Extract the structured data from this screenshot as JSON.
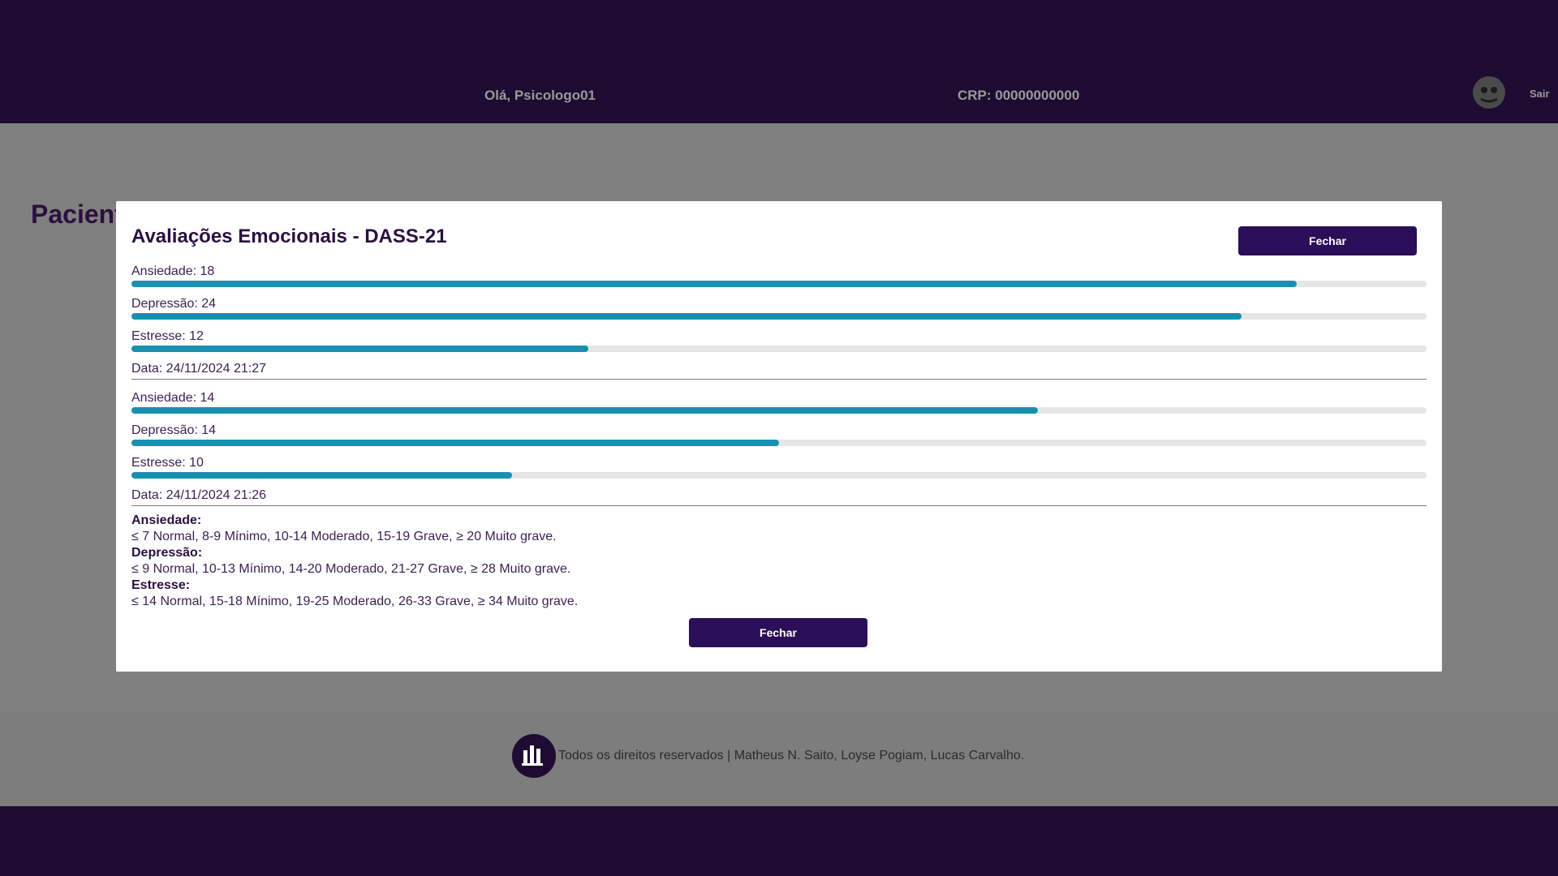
{
  "header": {
    "greeting": "Olá, Psicologo01",
    "crp": "CRP: 00000000000",
    "logout_label": "Sair"
  },
  "page": {
    "heading": "Pacient"
  },
  "modal": {
    "title": "Avaliações Emocionais - DASS-21",
    "close_top_label": "Fechar",
    "close_bottom_label": "Fechar",
    "evaluations": [
      {
        "metrics": [
          {
            "label": "Ansiedade: 18",
            "fraction": 0.9
          },
          {
            "label": "Depressão: 24",
            "fraction": 0.857
          },
          {
            "label": "Estresse: 12",
            "fraction": 0.353
          }
        ],
        "date": "Data: 24/11/2024 21:27"
      },
      {
        "metrics": [
          {
            "label": "Ansiedade: 14",
            "fraction": 0.7
          },
          {
            "label": "Depressão: 14",
            "fraction": 0.5
          },
          {
            "label": "Estresse: 10",
            "fraction": 0.294
          }
        ],
        "date": "Data: 24/11/2024 21:26"
      }
    ],
    "legend": [
      {
        "title": "Ansiedade:",
        "text": "≤ 7 Normal, 8-9 Mínimo, 10-14 Moderado, 15-19 Grave, ≥ 20 Muito grave."
      },
      {
        "title": "Depressão:",
        "text": "≤ 9 Normal, 10-13 Mínimo, 14-20 Moderado, 21-27 Grave, ≥ 28 Muito grave."
      },
      {
        "title": "Estresse:",
        "text": "≤ 14 Normal, 15-18 Mínimo, 19-25 Moderado, 26-33 Grave, ≥ 34 Muito grave."
      }
    ]
  },
  "footer": {
    "text": "Todos os direitos reservados | Matheus N. Saito, Loyse Pogiam, Lucas Carvalho."
  },
  "colors": {
    "bar_fill": "#1a8fb0",
    "button": "#2a0f58",
    "header": "#1e0c33",
    "overlay": "#808080"
  }
}
